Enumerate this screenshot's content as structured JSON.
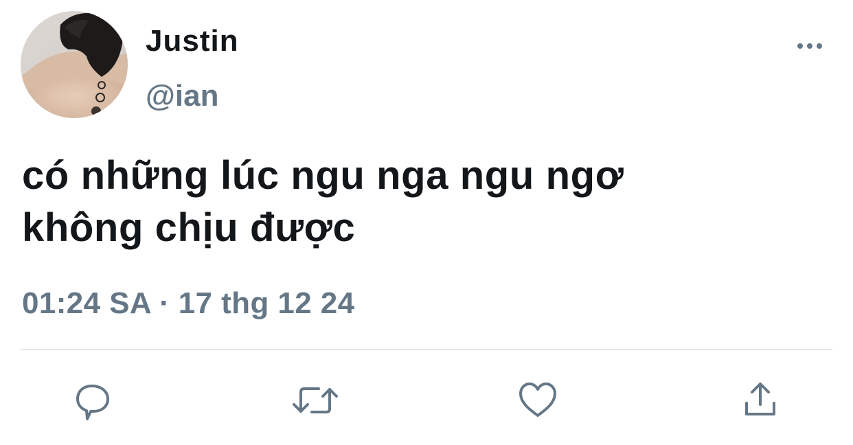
{
  "user": {
    "display_name": "Justin",
    "handle": "@ian"
  },
  "tweet": {
    "text_lines": [
      "có những lúc ngu nga ngu ngơ",
      "không chịu được"
    ],
    "time": "01:24 SA",
    "separator": "·",
    "date": "17 thg 12 24"
  },
  "icons": {
    "more": "more-dots-icon",
    "reply": "reply-bubble-icon",
    "retweet": "retweet-icon",
    "like": "heart-icon",
    "share": "share-upload-icon"
  },
  "colors": {
    "text_primary": "#14171a",
    "text_secondary": "#657786",
    "icon": "#657786",
    "divider": "#e1e8ed",
    "background": "#ffffff"
  }
}
